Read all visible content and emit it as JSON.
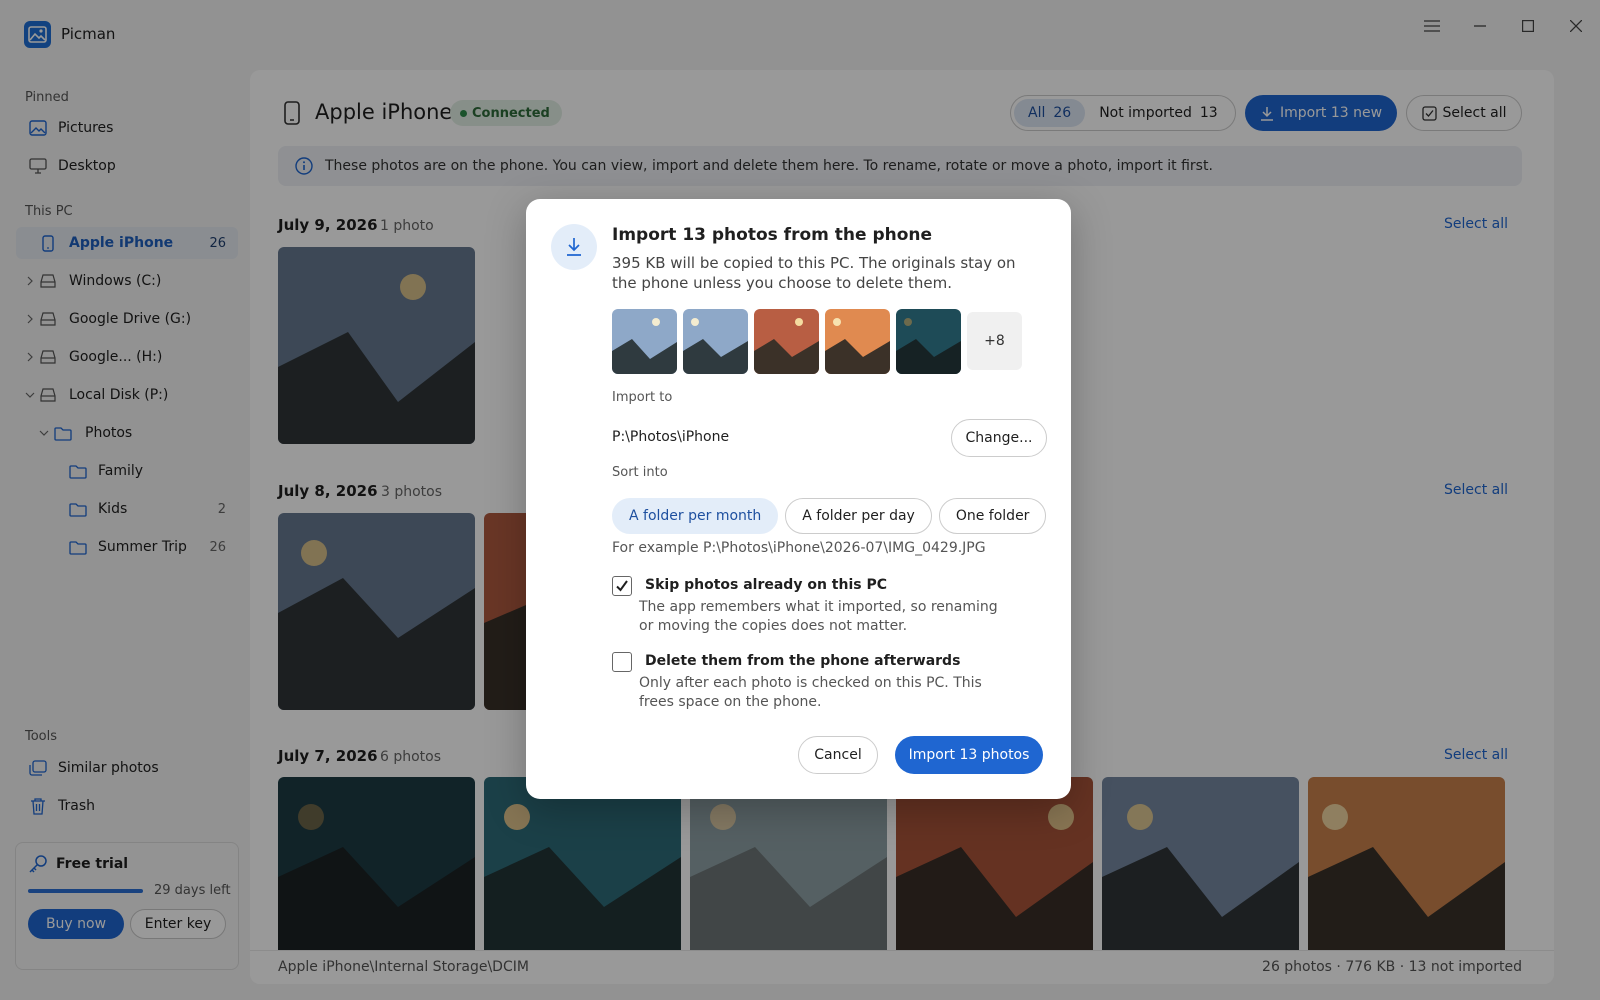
{
  "app": {
    "title": "Picman"
  },
  "sidebar": {
    "pinned_label": "Pinned",
    "pinned": [
      {
        "label": "Pictures",
        "icon": "image-icon"
      },
      {
        "label": "Desktop",
        "icon": "monitor-icon"
      }
    ],
    "thispc_label": "This PC",
    "devices": [
      {
        "label": "Apple iPhone",
        "count": "26",
        "active": true
      },
      {
        "label": "Windows (C:)"
      },
      {
        "label": "Google Drive (G:)"
      },
      {
        "label": "Google... (H:)"
      },
      {
        "label": "Local Disk (P:)"
      },
      {
        "label": "Photos"
      },
      {
        "label": "Family"
      },
      {
        "label": "Kids",
        "count": "2"
      },
      {
        "label": "Summer Trip",
        "count": "26"
      }
    ],
    "tools_label": "Tools",
    "tools": [
      {
        "label": "Similar photos"
      },
      {
        "label": "Trash"
      }
    ],
    "trial": {
      "title": "Free trial",
      "progress": 0.97,
      "days_left": "29 days left",
      "buy_label": "Buy now",
      "key_label": "Enter key"
    }
  },
  "header": {
    "device": "Apple iPhone",
    "status": "Connected",
    "filter_all": "All",
    "filter_all_count": "26",
    "filter_not_imported": "Not imported",
    "filter_not_imported_count": "13",
    "import_new_label": "Import 13 new",
    "select_all_label": "Select all"
  },
  "info": "These photos are on the phone. You can view, import and delete them here. To rename, rotate or move a photo, import it first.",
  "groups": [
    {
      "date": "July 9, 2026",
      "count": "1 photo",
      "select": "Select all"
    },
    {
      "date": "July 8, 2026",
      "count": "3 photos",
      "select": "Select all"
    },
    {
      "date": "July 7, 2026",
      "count": "6 photos",
      "select": "Select all"
    }
  ],
  "status": {
    "path": "Apple iPhone\\Internal Storage\\DCIM",
    "summary": "26 photos · 776 KB · 13 not imported"
  },
  "dialog": {
    "title": "Import 13 photos from the phone",
    "description": "395 KB will be copied to this PC. The originals stay on the phone unless you choose to delete them.",
    "more_count": "+8",
    "import_to_label": "Import to",
    "path": "P:\\Photos\\iPhone",
    "change_label": "Change...",
    "sort_label": "Sort into",
    "sort_options": [
      "A folder per month",
      "A folder per day",
      "One folder"
    ],
    "sort_selected": 0,
    "example": "For example P:\\Photos\\iPhone\\2026-07\\IMG_0429.JPG",
    "skip": {
      "title": "Skip photos already on this PC",
      "desc": "The app remembers what it imported, so renaming or moving the copies does not matter.",
      "checked": true
    },
    "delete": {
      "title": "Delete them from the phone afterwards",
      "desc": "Only after each photo is checked on this PC. This frees space on the phone.",
      "checked": false
    },
    "cancel_label": "Cancel",
    "import_label": "Import 13 photos"
  },
  "colors": {
    "accent": "#1f66d1",
    "connected": "#2e8b4a"
  }
}
